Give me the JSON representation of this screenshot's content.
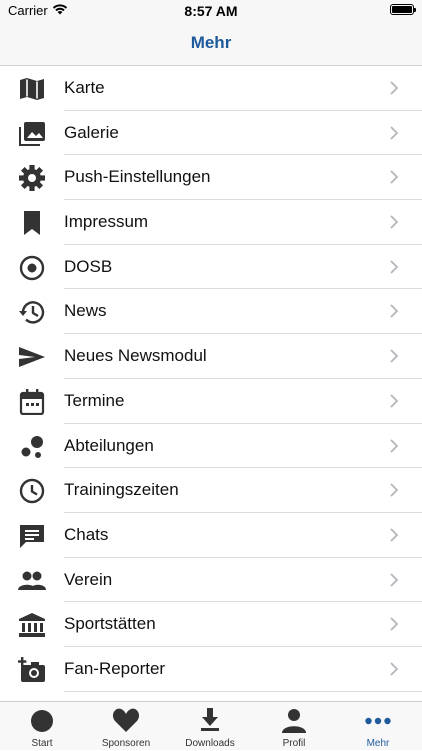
{
  "status": {
    "carrier": "Carrier",
    "time": "8:57 AM"
  },
  "nav": {
    "title": "Mehr"
  },
  "menu": [
    {
      "label": "Karte",
      "icon": "map-icon"
    },
    {
      "label": "Galerie",
      "icon": "gallery-icon"
    },
    {
      "label": "Push-Einstellungen",
      "icon": "gear-icon"
    },
    {
      "label": "Impressum",
      "icon": "bookmark-icon"
    },
    {
      "label": "DOSB",
      "icon": "target-icon"
    },
    {
      "label": "News",
      "icon": "history-icon"
    },
    {
      "label": "Neues Newsmodul",
      "icon": "send-icon"
    },
    {
      "label": "Termine",
      "icon": "calendar-icon"
    },
    {
      "label": "Abteilungen",
      "icon": "bubbles-icon"
    },
    {
      "label": "Trainingszeiten",
      "icon": "clock-icon"
    },
    {
      "label": "Chats",
      "icon": "chat-icon"
    },
    {
      "label": "Verein",
      "icon": "people-icon"
    },
    {
      "label": "Sportstätten",
      "icon": "building-icon"
    },
    {
      "label": "Fan-Reporter",
      "icon": "add-camera-icon"
    }
  ],
  "tabs": [
    {
      "label": "Start",
      "icon": "circle-icon"
    },
    {
      "label": "Sponsoren",
      "icon": "heart-icon"
    },
    {
      "label": "Downloads",
      "icon": "download-icon"
    },
    {
      "label": "Profil",
      "icon": "person-icon"
    },
    {
      "label": "Mehr",
      "icon": "more-icon"
    }
  ],
  "colors": {
    "accent": "#1f5a9b",
    "icon": "#333333",
    "chevron": "#b5b5ba"
  }
}
